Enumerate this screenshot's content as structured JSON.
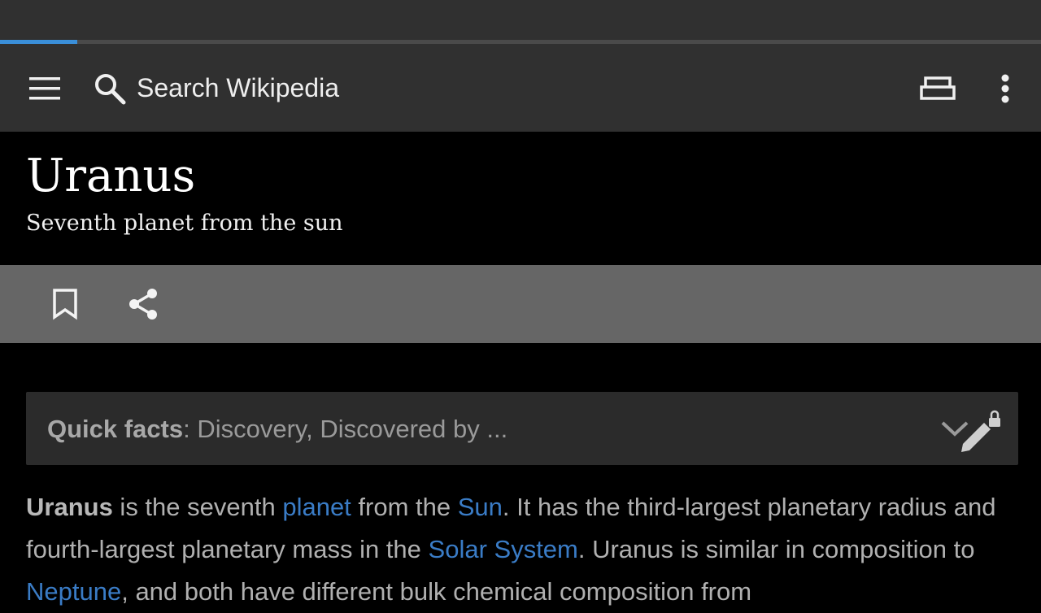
{
  "browser": {
    "load_progress_percent": 7.4
  },
  "toolbar": {
    "menu_icon": "menu-icon",
    "search_icon": "search-icon",
    "search_placeholder": "Search Wikipedia",
    "tabs_icon": "tabs-icon",
    "overflow_icon": "more-vert-icon"
  },
  "article": {
    "title": "Uranus",
    "description": "Seventh planet from the sun",
    "actions": {
      "bookmark_icon": "bookmark-icon",
      "share_icon": "share-icon"
    },
    "quick_facts": {
      "label": "Quick facts",
      "summary": ": Discovery, Discovered by ...",
      "chevron_icon": "chevron-down-icon",
      "edit_icon": "edit-locked-icon"
    },
    "paragraph": {
      "bold_term": "Uranus",
      "t1": " is the seventh ",
      "link1": "planet",
      "t2": " from the ",
      "link2": "Sun",
      "t3": ". It has the third-largest planetary radius and fourth-largest planetary mass in the ",
      "link3": "Solar System",
      "t4": ". Uranus is similar in composition to ",
      "link4": "Neptune",
      "t5": ", and both have different bulk chemical composition from"
    }
  },
  "colors": {
    "toolbar_bg": "#303030",
    "header_bg": "#000000",
    "actionbar_bg": "#666666",
    "quickfacts_bg": "#2b2b2b",
    "link": "#3a7cc6",
    "progress": "#3a8fd9"
  }
}
